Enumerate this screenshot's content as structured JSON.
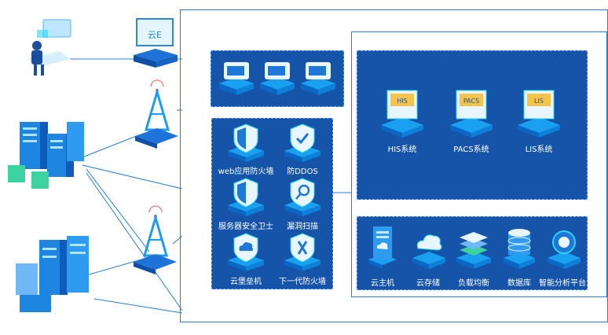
{
  "colors": {
    "panel": "#1554a8",
    "line": "#2a7bd8",
    "accent": "#2bd4f5"
  },
  "security": {
    "items": [
      {
        "label": "web应用防火墙",
        "icon": "shield-icon"
      },
      {
        "label": "防DDOS",
        "icon": "shield-check-icon"
      },
      {
        "label": "服务器安全卫士",
        "icon": "shield-icon"
      },
      {
        "label": "漏洞扫描",
        "icon": "magnifier-shield-icon"
      },
      {
        "label": "云堡垒机",
        "icon": "cloud-shield-icon"
      },
      {
        "label": "下一代防火墙",
        "icon": "shield-check-icon"
      }
    ]
  },
  "systems": {
    "items": [
      {
        "label": "HIS系统",
        "screen": "HIS"
      },
      {
        "label": "PACS系统",
        "screen": "PACS"
      },
      {
        "label": "LIS系统",
        "screen": "LIS"
      }
    ]
  },
  "cloud": {
    "items": [
      {
        "label": "云主机",
        "icon": "server-icon"
      },
      {
        "label": "云存储",
        "icon": "cloud-storage-icon"
      },
      {
        "label": "负载均衡",
        "icon": "load-balance-icon"
      },
      {
        "label": "数据库",
        "icon": "database-icon"
      },
      {
        "label": "智能分析平台",
        "icon": "ai-platform-icon"
      }
    ]
  },
  "left": {
    "monitor_screen": "云E",
    "devices": [
      "user-workstation-icon",
      "monitor-icon",
      "server-cluster-icon",
      "signal-tower-icon",
      "signal-tower-icon",
      "server-cluster-icon"
    ]
  }
}
